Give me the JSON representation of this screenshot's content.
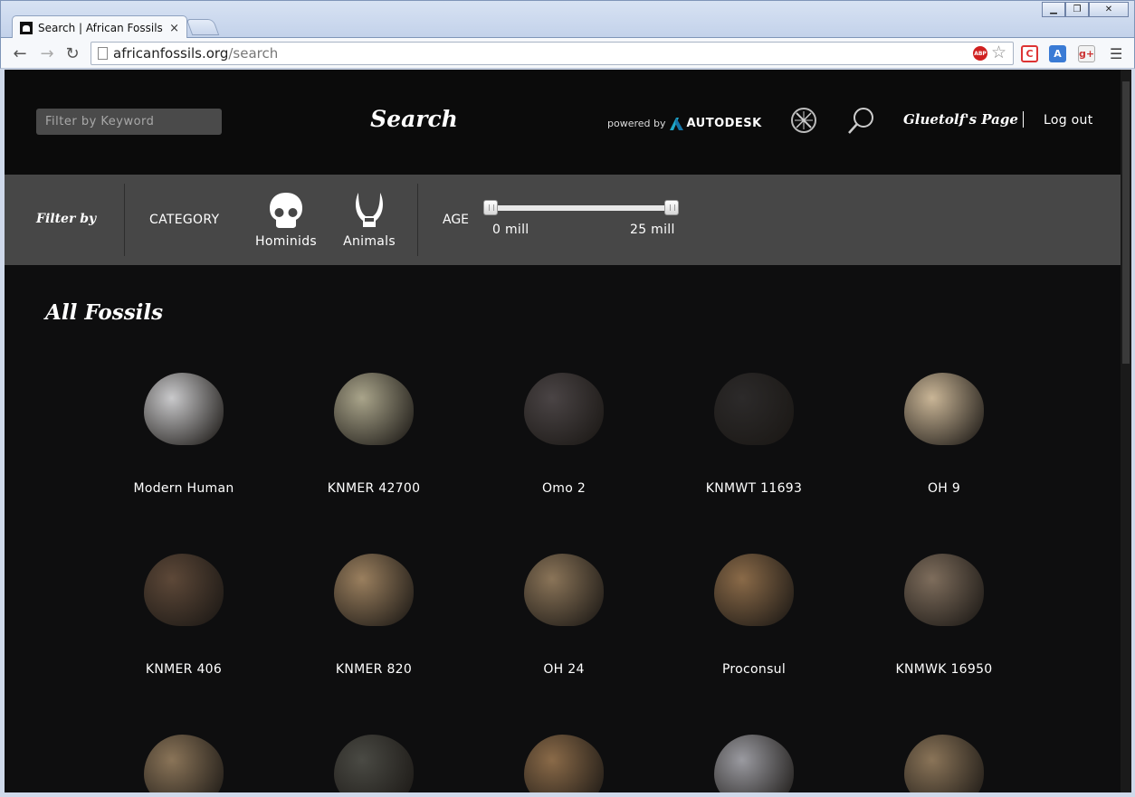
{
  "browser": {
    "tab_title": "Search | African Fossils",
    "tab_close": "×",
    "url_host": "africanfossils.org",
    "url_path": "/search",
    "abp_badge": "ABP",
    "window_buttons": {
      "minimize": "▁",
      "maximize": "❐",
      "close": "✕"
    }
  },
  "header": {
    "keyword_placeholder": "Filter by Keyword",
    "title": "Search",
    "powered_by": "powered by",
    "brand": "AUTODESK",
    "user_link": "Gluetolf's Page",
    "logout": "Log out"
  },
  "filters": {
    "filter_by": "Filter by",
    "category_label": "CATEGORY",
    "categories": [
      {
        "label": "Hominids",
        "icon": "skull-icon"
      },
      {
        "label": "Animals",
        "icon": "horns-icon"
      }
    ],
    "age_label": "AGE",
    "age_min": "0 mill",
    "age_max": "25 mill"
  },
  "results": {
    "title": "All Fossils",
    "items": [
      {
        "label": "Modern Human",
        "color": "#c9c9cb"
      },
      {
        "label": "KNMER 42700",
        "color": "#a9a48a"
      },
      {
        "label": "Omo 2",
        "color": "#4a4445"
      },
      {
        "label": "KNMWT 11693",
        "color": "#2c2a2a"
      },
      {
        "label": "OH 9",
        "color": "#c9b596"
      },
      {
        "label": "KNMER 406",
        "color": "#5d4838"
      },
      {
        "label": "KNMER 820",
        "color": "#9a7f5e"
      },
      {
        "label": "OH 24",
        "color": "#8a7458"
      },
      {
        "label": "Proconsul",
        "color": "#8a6a48"
      },
      {
        "label": "KNMWK 16950",
        "color": "#7e6d5c"
      },
      {
        "label": "",
        "color": "#8a7458"
      },
      {
        "label": "",
        "color": "#4a4a44"
      },
      {
        "label": "",
        "color": "#8a6a48"
      },
      {
        "label": "",
        "color": "#9a9aa0"
      },
      {
        "label": "",
        "color": "#8a7458"
      }
    ]
  }
}
